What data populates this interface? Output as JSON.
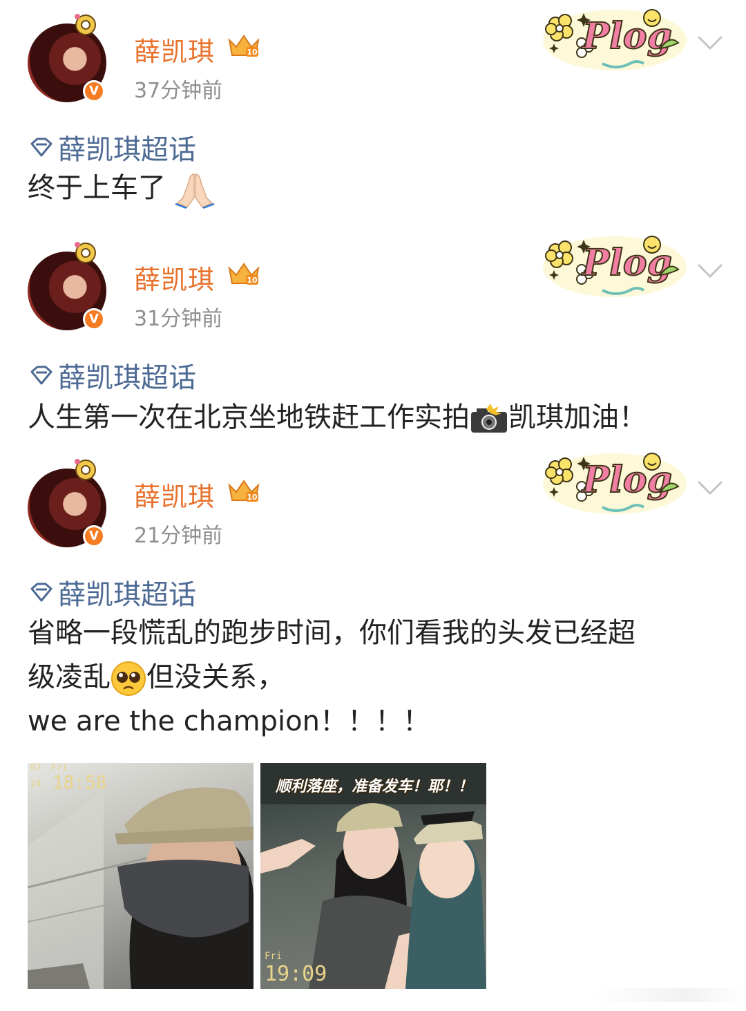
{
  "posts": [
    {
      "username": "薛凯琪",
      "time": "37分钟前",
      "topic": "薛凯琪超话",
      "text": "终于上车了",
      "emoji": "folded-hands"
    },
    {
      "username": "薛凯琪",
      "time": "31分钟前",
      "topic": "薛凯琪超话",
      "text_a": "人生第一次在北京坐地铁赶工作实拍",
      "emoji": "camera-flash",
      "text_b": "凯琪加油！"
    },
    {
      "username": "薛凯琪",
      "time": "21分钟前",
      "topic": "薛凯琪超话",
      "text_line1": "省略一段慌乱的跑步时间，你们看我的头发已经超",
      "text_line2a": "级凌乱",
      "emoji": "pleading-face",
      "text_line2b": "但没关系，",
      "text_line3": "we are the champion！！！！"
    }
  ],
  "badges": {
    "verified": "V",
    "vip_level": "10",
    "plog_sticker": "Plog"
  },
  "photos": [
    {
      "stamp_date_top": "07",
      "stamp_day": "Fri",
      "stamp_date_bottom": "24",
      "stamp_time": "18:58"
    },
    {
      "caption": "顺利落座，准备发车！耶！！",
      "stamp_day": "Fri",
      "stamp_time": "19:09"
    }
  ],
  "colors": {
    "username": "#e8712b",
    "topic": "#4d6a94",
    "time": "#8e8e8e",
    "verified": "#f57c22"
  }
}
